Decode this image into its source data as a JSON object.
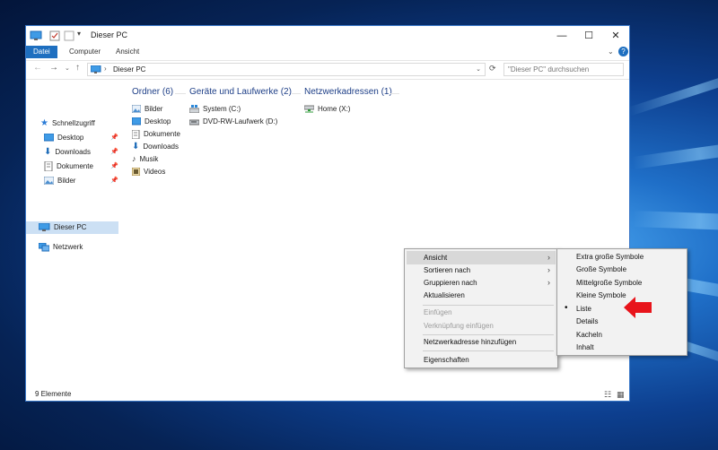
{
  "window": {
    "title": "Dieser PC",
    "controls": {
      "minimize": "—",
      "maximize": "☐",
      "close": "✕"
    }
  },
  "ribbon": {
    "tabs": [
      {
        "label": "Datei",
        "active": true
      },
      {
        "label": "Computer",
        "active": false
      },
      {
        "label": "Ansicht",
        "active": false
      }
    ]
  },
  "address": {
    "path": "Dieser PC",
    "search_placeholder": "\"Dieser PC\" durchsuchen"
  },
  "sidebar": {
    "quick_access": "Schnellzugriff",
    "items": [
      {
        "label": "Desktop",
        "icon": "desktop-icon",
        "pinned": true
      },
      {
        "label": "Downloads",
        "icon": "download-icon",
        "pinned": true
      },
      {
        "label": "Dokumente",
        "icon": "documents-icon",
        "pinned": true
      },
      {
        "label": "Bilder",
        "icon": "pictures-icon",
        "pinned": true
      }
    ],
    "this_pc": "Dieser PC",
    "network": "Netzwerk"
  },
  "content": {
    "groups": [
      {
        "heading": "Ordner (6)",
        "items": [
          "Bilder",
          "Desktop",
          "Dokumente",
          "Downloads",
          "Musik",
          "Videos"
        ]
      },
      {
        "heading": "Geräte und Laufwerke (2)",
        "items": [
          "System (C:)",
          "DVD-RW-Laufwerk (D:)"
        ]
      },
      {
        "heading": "Netzwerkadressen (1)",
        "items": [
          "Home (X:)"
        ]
      }
    ]
  },
  "status": {
    "count": "9 Elemente"
  },
  "context_menu": {
    "items": [
      "Ansicht",
      "Sortieren nach",
      "Gruppieren nach",
      "Aktualisieren",
      "Einfügen",
      "Verknüpfung einfügen",
      "Netzwerkadresse hinzufügen",
      "Eigenschaften"
    ]
  },
  "submenu": {
    "items": [
      "Extra große Symbole",
      "Große Symbole",
      "Mittelgroße Symbole",
      "Kleine Symbole",
      "Liste",
      "Details",
      "Kacheln",
      "Inhalt"
    ],
    "selected": "Liste",
    "bullet": "•"
  },
  "colors": {
    "accent": "#1e6fc0",
    "pointer_arrow": "#e8141b"
  }
}
